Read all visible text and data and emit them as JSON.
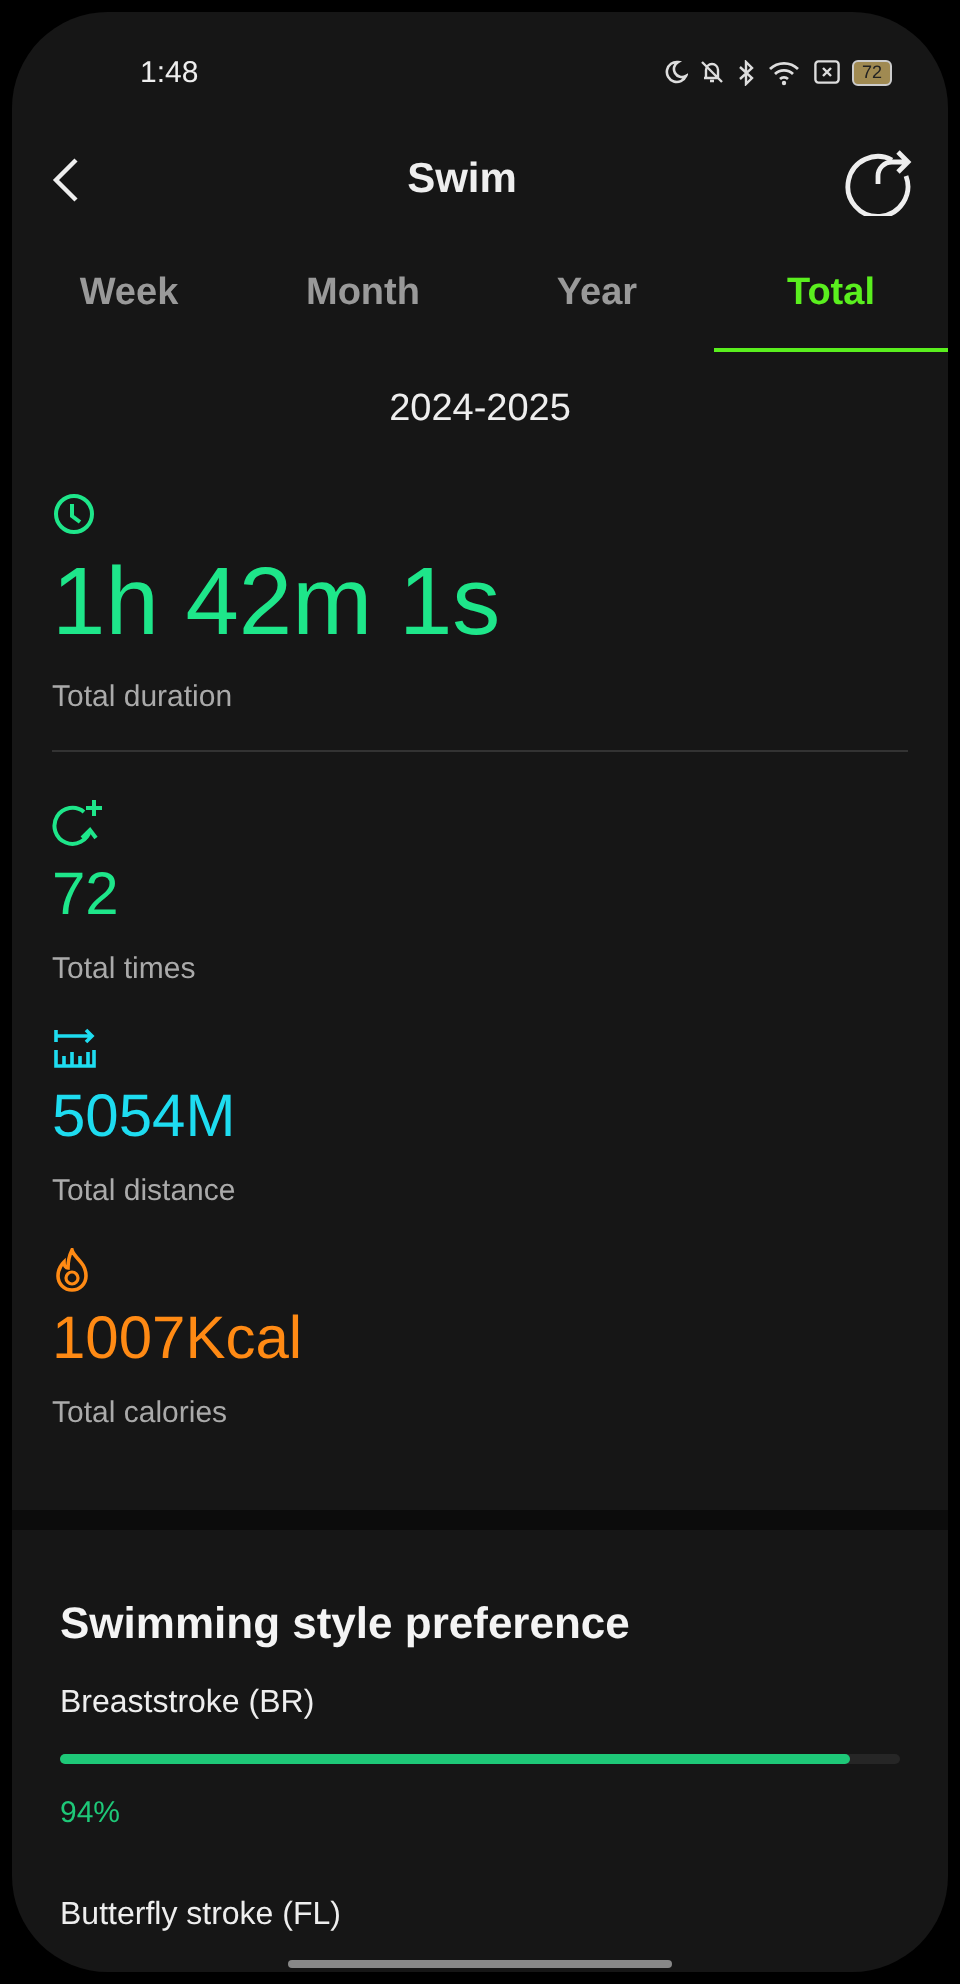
{
  "status_bar": {
    "time": "1:48",
    "battery": "72"
  },
  "header": {
    "title": "Swim"
  },
  "tabs": [
    {
      "label": "Week",
      "selected": false
    },
    {
      "label": "Month",
      "selected": false
    },
    {
      "label": "Year",
      "selected": false
    },
    {
      "label": "Total",
      "selected": true
    }
  ],
  "period": "2024-2025",
  "stats": [
    {
      "kind": "duration",
      "value": "1h 42m 1s",
      "label": "Total duration",
      "color": "#1ee68a"
    },
    {
      "kind": "times",
      "value": "72",
      "label": "Total times",
      "color": "#1ee68a"
    },
    {
      "kind": "distance",
      "value": "5054M",
      "label": "Total distance",
      "color": "#1edcf0"
    },
    {
      "kind": "calories",
      "value": "1007Kcal",
      "label": "Total calories",
      "color": "#ff8a14"
    }
  ],
  "styles": {
    "title": "Swimming style preference",
    "items": [
      {
        "name": "Breaststroke (BR)",
        "level": 0.94,
        "percent": "94%"
      },
      {
        "name": "Butterfly stroke (FL)"
      }
    ]
  }
}
